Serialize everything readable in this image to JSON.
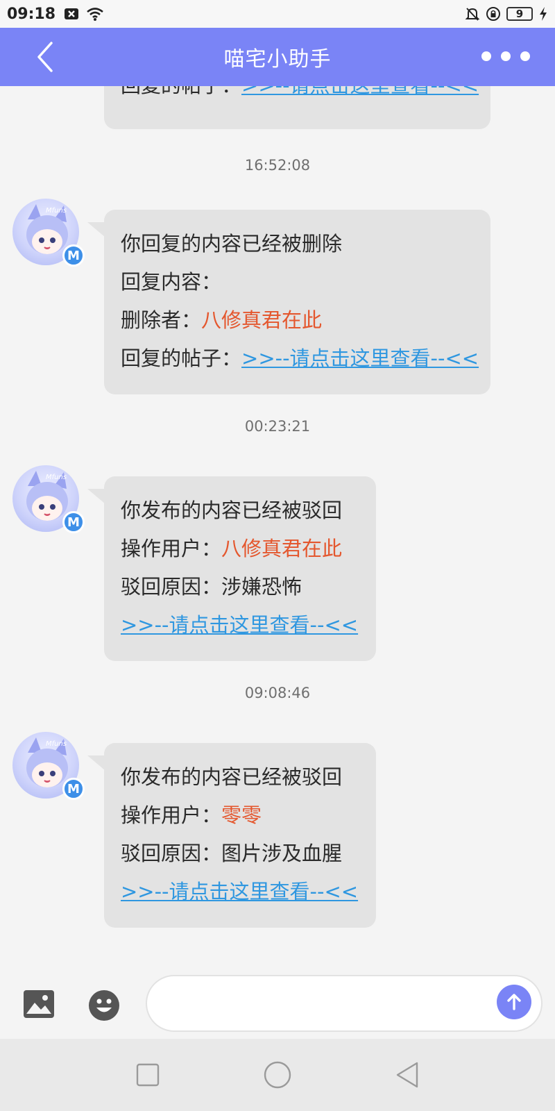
{
  "status_bar": {
    "time": "09:18",
    "battery": "9",
    "icons": [
      "notification-x-icon",
      "wifi-icon",
      "mute-bell-icon",
      "rotation-lock-icon",
      "battery-icon",
      "charging-icon"
    ]
  },
  "header": {
    "title": "喵宅小助手",
    "back_icon": "chevron-left-icon",
    "more_icon": "more-dots-icon",
    "color": "#7a84f6"
  },
  "messages": [
    {
      "partial": true,
      "lines": [
        {
          "label": "回复的帖子：",
          "value": ">>--请点击这里查看--<<",
          "style": "link"
        }
      ]
    },
    {
      "time": "16:52:08",
      "lines": [
        {
          "label": "你回复的内容已经被删除",
          "value": "",
          "style": ""
        },
        {
          "label": "回复内容：",
          "value": "",
          "style": ""
        },
        {
          "label": "删除者：",
          "value": "八修真君在此",
          "style": "red"
        },
        {
          "label": "回复的帖子：",
          "value": ">>--请点击这里查看--<<",
          "style": "link"
        }
      ]
    },
    {
      "time": "00:23:21",
      "lines": [
        {
          "label": "你发布的内容已经被驳回",
          "value": "",
          "style": ""
        },
        {
          "label": "操作用户：",
          "value": "八修真君在此",
          "style": "red"
        },
        {
          "label": "驳回原因：",
          "value": "涉嫌恐怖",
          "style": ""
        },
        {
          "label": "",
          "value": ">>--请点击这里查看--<<",
          "style": "link"
        }
      ]
    },
    {
      "time": "09:08:46",
      "lines": [
        {
          "label": "你发布的内容已经被驳回",
          "value": "",
          "style": ""
        },
        {
          "label": "操作用户：",
          "value": "零零",
          "style": "red"
        },
        {
          "label": "驳回原因：",
          "value": "图片涉及血腥",
          "style": ""
        },
        {
          "label": "",
          "value": ">>--请点击这里查看--<<",
          "style": "link"
        }
      ]
    }
  ],
  "avatar": {
    "badge": "M",
    "text": "Mfuns"
  },
  "input_bar": {
    "value": "",
    "placeholder": "",
    "image_icon": "image-icon",
    "emoji_icon": "emoji-icon",
    "send_icon": "send-arrow-icon"
  },
  "nav_bar": {
    "icons": [
      "square-recent-icon",
      "circle-home-icon",
      "triangle-back-icon"
    ]
  },
  "colors": {
    "accent": "#7a84f6",
    "link": "#2f97e0",
    "highlight": "#e4572e",
    "bubble": "#e3e3e3"
  }
}
